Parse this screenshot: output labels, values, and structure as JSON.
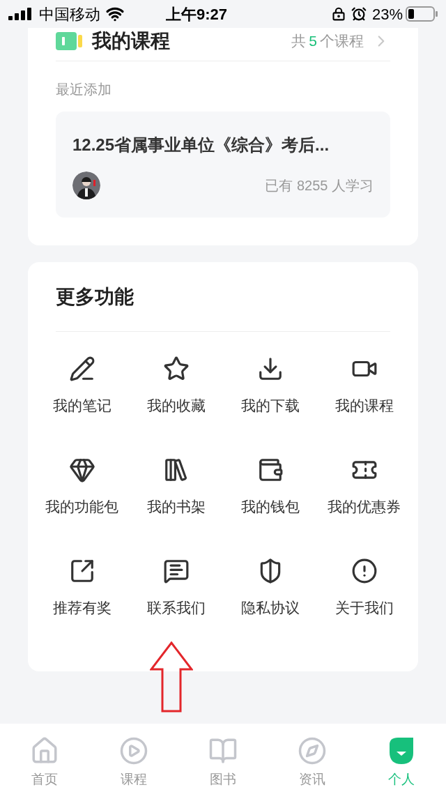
{
  "status_bar": {
    "carrier": "中国移动",
    "time": "上午9:27",
    "battery": "23%"
  },
  "my_courses": {
    "title": "我的课程",
    "count_prefix": "共",
    "count": "5",
    "count_suffix": "个课程",
    "section_label": "最近添加",
    "course": {
      "title": "12.25省属事业单位《综合》考后...",
      "learners": "已有 8255 人学习"
    }
  },
  "more_features": {
    "title": "更多功能",
    "items": [
      {
        "label": "我的笔记"
      },
      {
        "label": "我的收藏"
      },
      {
        "label": "我的下载"
      },
      {
        "label": "我的课程"
      },
      {
        "label": "我的功能包"
      },
      {
        "label": "我的书架"
      },
      {
        "label": "我的钱包"
      },
      {
        "label": "我的优惠券"
      },
      {
        "label": "推荐有奖"
      },
      {
        "label": "联系我们"
      },
      {
        "label": "隐私协议"
      },
      {
        "label": "关于我们"
      }
    ]
  },
  "tab_bar": [
    {
      "label": "首页",
      "selected": false
    },
    {
      "label": "课程",
      "selected": false
    },
    {
      "label": "图书",
      "selected": false
    },
    {
      "label": "资讯",
      "selected": false
    },
    {
      "label": "个人",
      "selected": true
    }
  ]
}
